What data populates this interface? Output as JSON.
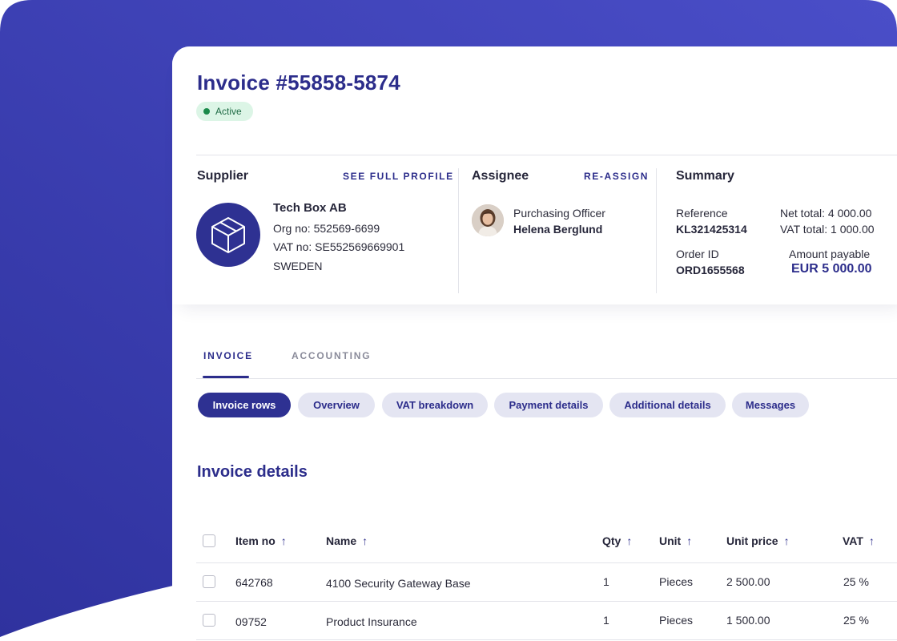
{
  "colors": {
    "primary": "#2c2d8b",
    "primary_dark": "#2e3192",
    "gradient_start": "#3537a6",
    "gradient_end": "#4b4fc9",
    "active_badge_bg": "#dcf5e6",
    "active_badge_dot": "#1a8a4a",
    "pill_bg": "#e4e5f2"
  },
  "invoice": {
    "title": "Invoice #55858-5874",
    "status": "Active"
  },
  "supplier": {
    "heading": "Supplier",
    "link": "SEE FULL PROFILE",
    "logo_icon": "box-icon",
    "name": "Tech Box AB",
    "org_no": "Org no: 552569-6699",
    "vat_no": "VAT no: SE552569669901",
    "country": "SWEDEN"
  },
  "assignee": {
    "heading": "Assignee",
    "link": "RE-ASSIGN",
    "role": "Purchasing Officer",
    "name": "Helena Berglund"
  },
  "summary": {
    "heading": "Summary",
    "reference_label": "Reference",
    "reference_value": "KL321425314",
    "order_label": "Order ID",
    "order_value": "ORD1655568",
    "net_total": "Net total: 4 000.00",
    "vat_total": "VAT total: 1 000.00",
    "amount_label": "Amount payable",
    "amount_value": "EUR  5 000.00"
  },
  "tabs": [
    {
      "label": "INVOICE",
      "active": true
    },
    {
      "label": "ACCOUNTING",
      "active": false
    }
  ],
  "pills": [
    {
      "label": "Invoice rows",
      "active": true
    },
    {
      "label": "Overview",
      "active": false
    },
    {
      "label": "VAT breakdown",
      "active": false
    },
    {
      "label": "Payment details",
      "active": false
    },
    {
      "label": "Additional details",
      "active": false
    },
    {
      "label": "Messages",
      "active": false
    }
  ],
  "details": {
    "title": "Invoice details",
    "columns": [
      "Item no",
      "Name",
      "Qty",
      "Unit",
      "Unit price",
      "VAT"
    ],
    "sort_icon": "arrow-up-icon",
    "rows": [
      {
        "item_no": "642768",
        "name": "4100 Security Gateway Base",
        "qty": "1",
        "unit": "Pieces",
        "unit_price": "2 500.00",
        "vat": "25 %"
      },
      {
        "item_no": "09752",
        "name": "Product Insurance",
        "qty": "1",
        "unit": "Pieces",
        "unit_price": "1 500.00",
        "vat": "25 %"
      }
    ]
  }
}
